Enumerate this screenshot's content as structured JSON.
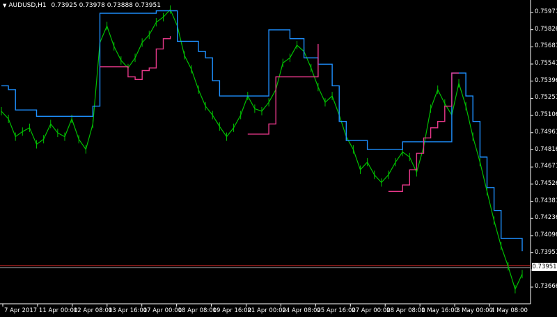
{
  "header": {
    "symbol_label": "AUDUSD,H1",
    "ohlc": "0.73925 0.73978 0.73888 0.73951"
  },
  "price_box": "0.73951",
  "colors": {
    "background": "#000000",
    "price_line": "#00C000",
    "upper_band": "#1E90FF",
    "lower_band": "#E8388A",
    "hline_red": "#FF3030",
    "hline_gray": "#9AA0A6",
    "axis": "#FFFFFF"
  },
  "chart_data": {
    "type": "line",
    "title": "",
    "y_axis_ticks": [
      "0.75971",
      "0.75826",
      "0.75681",
      "0.75541",
      "0.75396",
      "0.75251",
      "0.75106",
      "0.74961",
      "0.74816",
      "0.74671",
      "0.74526",
      "0.74381",
      "0.74236",
      "0.74096",
      "0.73951",
      "0.73806",
      "0.73666"
    ],
    "ylim": [
      0.73666,
      0.76
    ],
    "x_axis_ticks": [
      "7 Apr 2017",
      "11 Apr 00:00",
      "12 Apr 08:00",
      "13 Apr 16:00",
      "17 Apr 00:00",
      "18 Apr 08:00",
      "19 Apr 16:00",
      "21 Apr 00:00",
      "24 Apr 08:00",
      "25 Apr 16:00",
      "27 Apr 00:00",
      "28 Apr 08:00",
      "1 May 16:00",
      "3 May 00:00",
      "4 May 08:00"
    ],
    "x": [
      0,
      10,
      20,
      30,
      40,
      50,
      60,
      70,
      80,
      90,
      100,
      110,
      120,
      130,
      140,
      150,
      160,
      170,
      180,
      190,
      200,
      210,
      220,
      230,
      240,
      250,
      260,
      270,
      280,
      290,
      300,
      310,
      320,
      330,
      340,
      350,
      360,
      370,
      380,
      390,
      400,
      410,
      420,
      430,
      440,
      450,
      460,
      470,
      480,
      490,
      500,
      510,
      520,
      530,
      540,
      550,
      560,
      570,
      580,
      590,
      600,
      610,
      620,
      630,
      640,
      650,
      660,
      670,
      680,
      690,
      700,
      710,
      720,
      730,
      740
    ],
    "series": [
      {
        "values": [
          0.7518,
          0.7512,
          0.7498,
          0.7502,
          0.7505,
          0.7492,
          0.7496,
          0.7508,
          0.7501,
          0.7498,
          0.7512,
          0.7496,
          0.7488,
          0.7508,
          0.7572,
          0.7585,
          0.7569,
          0.7558,
          0.7552,
          0.756,
          0.7572,
          0.7578,
          0.7588,
          0.7592,
          0.7598,
          0.7585,
          0.7562,
          0.7551,
          0.7535,
          0.7522,
          0.7515,
          0.7506,
          0.7498,
          0.7505,
          0.7515,
          0.753,
          0.752,
          0.7518,
          0.7525,
          0.7535,
          0.7556,
          0.756,
          0.757,
          0.7565,
          0.7552,
          0.7537,
          0.7525,
          0.753,
          0.7515,
          0.7498,
          0.7488,
          0.7472,
          0.7478,
          0.7468,
          0.7462,
          0.7468,
          0.7478,
          0.7486,
          0.7482,
          0.747,
          0.749,
          0.752,
          0.7535,
          0.7524,
          0.7515,
          0.754,
          0.7522,
          0.7498,
          0.7478,
          0.7455,
          0.7432,
          0.7412,
          0.7396,
          0.7378,
          0.739
        ]
      },
      {
        "values": [
          0.7538,
          0.7535,
          0.7519,
          0.7519,
          0.7519,
          0.7514,
          0.7514,
          0.7514,
          0.7514,
          0.7514,
          0.7514,
          0.7514,
          0.7514,
          0.7522,
          0.7595,
          0.7595,
          0.7595,
          0.7595,
          0.7595,
          0.7595,
          0.7595,
          0.7595,
          0.7597,
          0.7597,
          0.7597,
          0.7573,
          0.7573,
          0.7573,
          0.7565,
          0.756,
          0.7542,
          0.753,
          0.753,
          0.753,
          0.753,
          0.753,
          0.753,
          0.753,
          0.7582,
          0.7582,
          0.7582,
          0.7575,
          0.7575,
          0.756,
          0.756,
          0.7555,
          0.7555,
          0.7538,
          0.751,
          0.7495,
          0.7495,
          0.7495,
          0.7488,
          0.7488,
          0.7488,
          0.7488,
          0.7488,
          0.7494,
          0.7494,
          0.7494,
          0.7494,
          0.7494,
          0.7494,
          0.7494,
          0.7548,
          0.7548,
          0.753,
          0.751,
          0.7482,
          0.7458,
          0.744,
          0.7418,
          0.7418,
          0.7418,
          0.7408
        ]
      },
      {
        "values": [
          null,
          null,
          null,
          null,
          null,
          null,
          null,
          null,
          null,
          null,
          null,
          null,
          null,
          null,
          0.7553,
          0.7553,
          0.7553,
          0.7553,
          0.7545,
          0.7543,
          0.755,
          0.7552,
          0.7567,
          0.7575,
          0.7577,
          null,
          null,
          null,
          null,
          null,
          null,
          null,
          null,
          null,
          null,
          0.75,
          0.75,
          0.75,
          0.7508,
          0.7545,
          0.7545,
          0.7545,
          0.7545,
          0.7545,
          0.7545,
          0.7571,
          null,
          null,
          null,
          null,
          null,
          null,
          null,
          null,
          null,
          0.7455,
          0.7455,
          0.746,
          0.7472,
          0.7485,
          0.7497,
          0.7505,
          0.751,
          0.7522,
          0.7548,
          0.7548,
          null,
          null,
          null,
          null,
          null,
          null,
          null,
          null,
          null
        ]
      }
    ],
    "current_price": 0.73951,
    "grid": false,
    "horizontal_levels": [
      0.73965,
      0.73951
    ]
  }
}
